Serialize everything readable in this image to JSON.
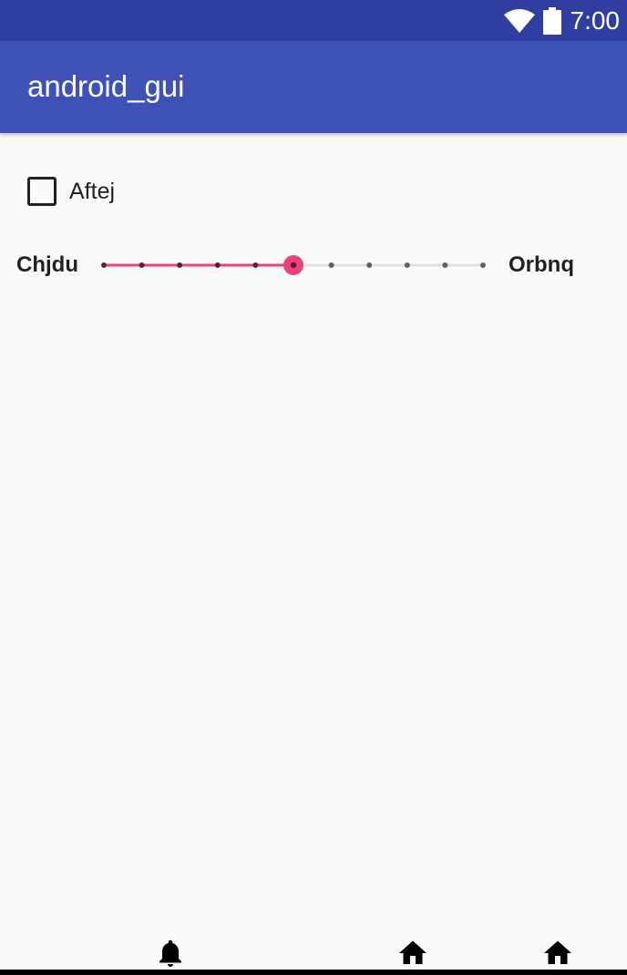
{
  "status_bar": {
    "time": "7:00",
    "icons": [
      "wifi-icon",
      "battery-icon"
    ]
  },
  "app_bar": {
    "title": "android_gui"
  },
  "checkbox": {
    "label": "Aftej",
    "checked": false
  },
  "slider": {
    "left_label": "Chjdu",
    "right_label": "Orbnq",
    "min": 0,
    "max": 10,
    "value": 5,
    "active_color": "#ec407a",
    "inactive_color": "#e0e0e0",
    "tick_color": "#616161"
  },
  "bottom_nav": {
    "icons": [
      "bell-icon",
      "home-icon",
      "home-icon"
    ]
  },
  "colors": {
    "status_bar": "#303f9f",
    "app_bar": "#3f51b5",
    "background": "#fafafa"
  }
}
